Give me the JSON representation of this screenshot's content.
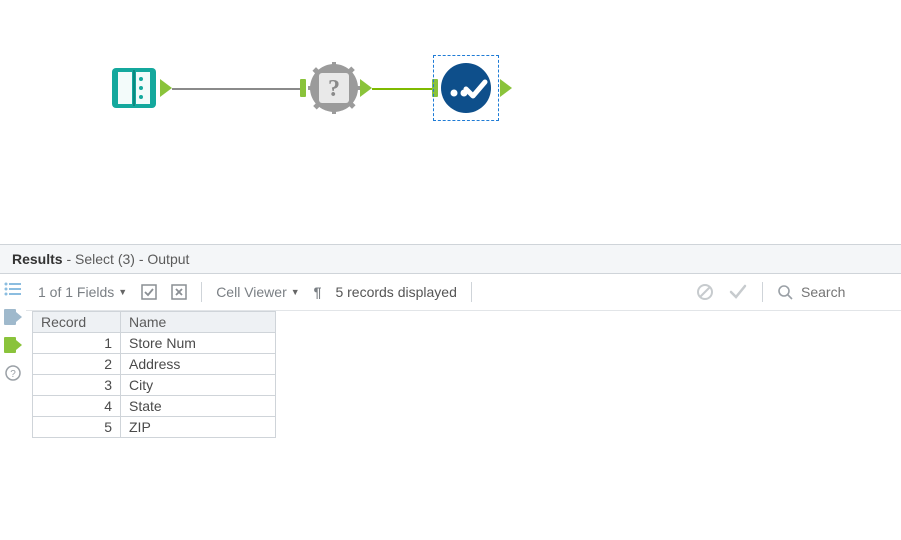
{
  "canvas": {
    "nodes": {
      "input": {
        "name": "input-data-tool"
      },
      "unknown": {
        "name": "missing-macro-tool"
      },
      "select": {
        "name": "select-tool"
      }
    }
  },
  "results": {
    "panel_label": "Results",
    "context": "Select (3) - Output",
    "fields_summary": "1 of 1 Fields",
    "cell_viewer_label": "Cell Viewer",
    "records_message": "5 records displayed",
    "search_placeholder": "Search"
  },
  "table": {
    "headers": {
      "record": "Record",
      "name": "Name"
    },
    "rows": [
      {
        "record": "1",
        "name": "Store Num"
      },
      {
        "record": "2",
        "name": "Address"
      },
      {
        "record": "3",
        "name": "City"
      },
      {
        "record": "4",
        "name": "State"
      },
      {
        "record": "5",
        "name": "ZIP"
      }
    ]
  },
  "colors": {
    "accent_green": "#0fa3a3",
    "alteryx_blue": "#0e4f8b",
    "lime": "#8ac33b"
  }
}
